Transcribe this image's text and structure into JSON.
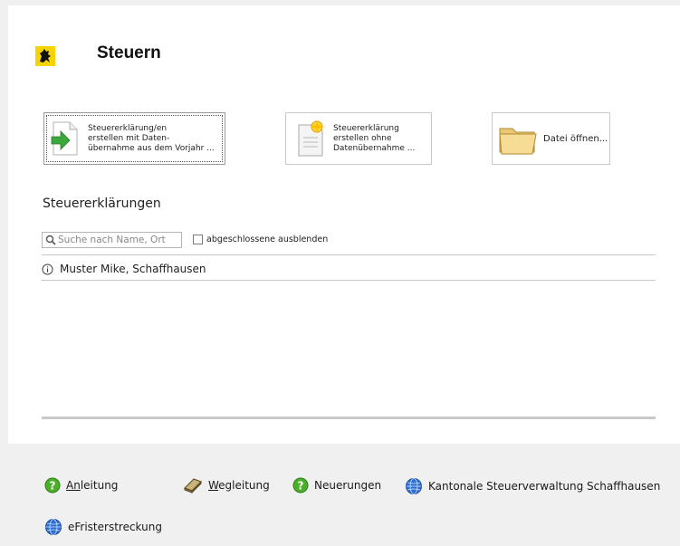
{
  "header": {
    "title": "Steuern"
  },
  "actions": [
    {
      "label": "Steuererklärung/en\nerstellen mit Daten-\nübernahme aus dem Vorjahr ...",
      "icon": "document-arrow-icon"
    },
    {
      "label": "Steuererklärung\nerstellen ohne\nDatenübernahme ...",
      "icon": "new-document-icon"
    },
    {
      "label": "Datei öffnen...",
      "icon": "folder-icon"
    }
  ],
  "list": {
    "title": "Steuererklärungen",
    "search_placeholder": "Suche nach Name, Ort",
    "checkbox_label": "abgeschlossene ausblenden",
    "checkbox_checked": false,
    "rows": [
      {
        "name": "Muster Mike, Schaffhausen",
        "icon": "info-icon"
      }
    ]
  },
  "footer": {
    "links": [
      {
        "accel": "An",
        "rest": "leitung",
        "icon": "help-icon"
      },
      {
        "accel": "W",
        "rest": "egleitung",
        "icon": "book-icon"
      },
      {
        "accel": "",
        "rest": "Neuerungen",
        "icon": "help-icon"
      },
      {
        "accel": "",
        "rest": "Kantonale Steuerverwaltung Schaffhausen",
        "icon": "globe-icon"
      },
      {
        "accel": "",
        "rest": "eFristerstreckung",
        "icon": "globe-icon"
      }
    ]
  },
  "colors": {
    "help_green": "#4caf2a",
    "globe_blue": "#2f6fd0",
    "logo_yellow": "#f5d400"
  }
}
